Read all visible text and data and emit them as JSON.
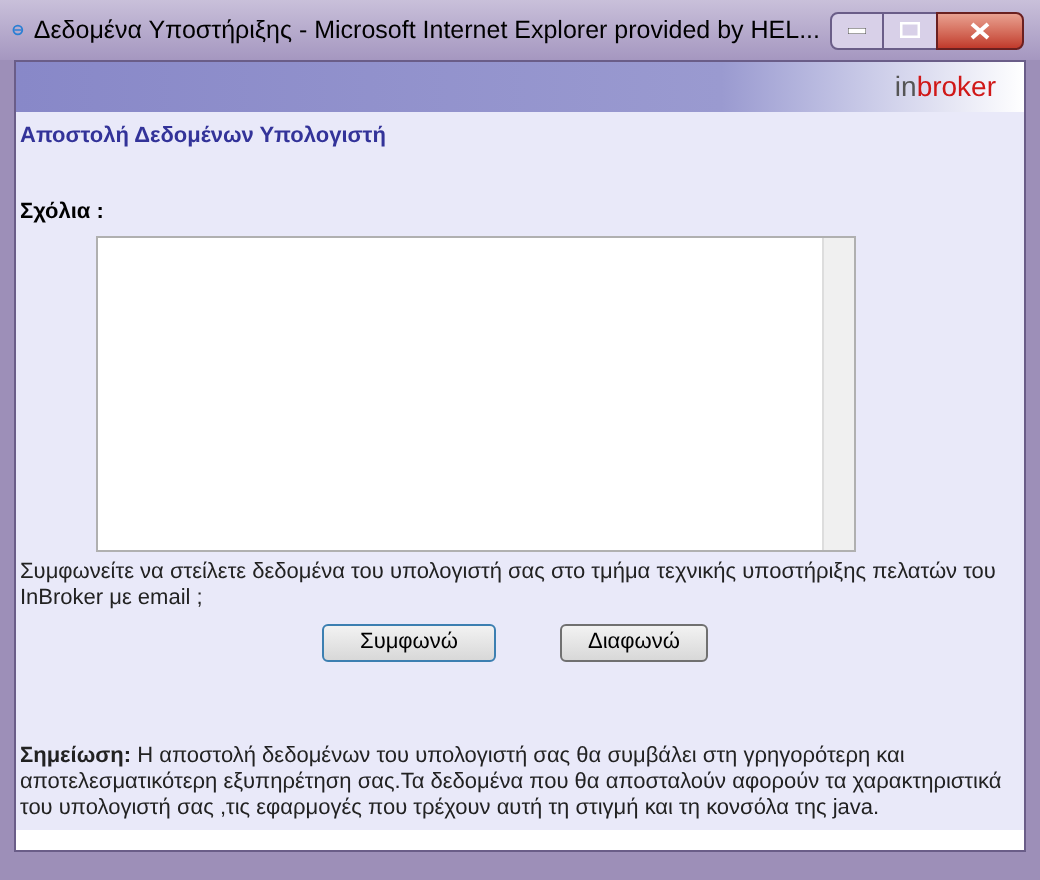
{
  "window": {
    "title": "Δεδομένα Υποστήριξης - Microsoft Internet Explorer provided by HEL..."
  },
  "logo": {
    "prefix": "in",
    "suffix": "broker"
  },
  "heading": "Αποστολή Δεδομένων Υπολογιστή",
  "comments": {
    "label": "Σχόλια :"
  },
  "question": "Συμφωνείτε να στείλετε δεδομένα του υπολογιστή σας στο τμήμα τεχνικής υποστήριξης πελατών του InBroker με email ;",
  "buttons": [
    {
      "label": "Συμφωνώ",
      "selected": true
    },
    {
      "label": "Διαφωνώ",
      "selected": false
    }
  ],
  "note": "**Σημείωση:**  Η αποστολή δεδομένων του υπολογιστή σας θα συμβάλει στη γρηγορότερη και αποτελεσματικότερη εξυπηρέτηση σας.Τα δεδομένα που θα αποσταλούν αφορούν τα χαρακτηριστικά του υπολογιστή σας ,τις εφαρμογές που τρέχουν αυτή τη στιγμή και τη κονσόλα της java."
}
